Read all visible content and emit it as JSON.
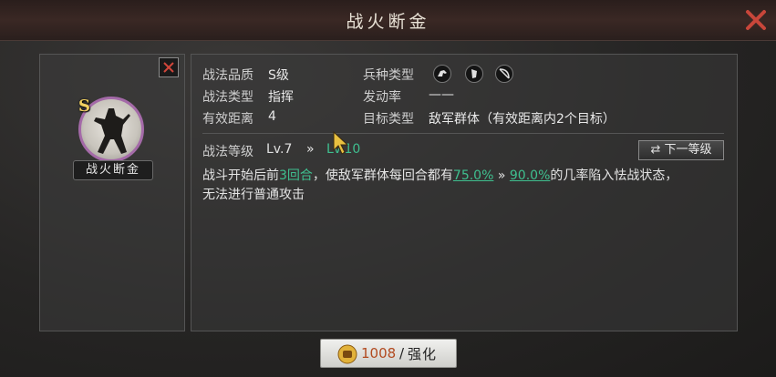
{
  "window": {
    "title": "战火断金"
  },
  "tactic": {
    "grade_badge": "S",
    "name": "战火断金"
  },
  "attributes": {
    "quality_label": "战法品质",
    "quality_value": "S级",
    "type_label": "战法类型",
    "type_value": "指挥",
    "range_label": "有效距离",
    "range_value": "4",
    "unit_label": "兵种类型",
    "unit_icons": [
      "cavalry-icon",
      "shield-icon",
      "bow-icon"
    ],
    "rate_label": "发动率",
    "rate_value": "——",
    "target_label": "目标类型",
    "target_value": "敌军群体（有效距离内2个目标）"
  },
  "level": {
    "label": "战法等级",
    "current": "Lv.7",
    "arrow": "»",
    "next": "Lv.10",
    "next_button_label": "下一等级"
  },
  "description": {
    "part1": "战斗开始后前",
    "rounds": "3回合",
    "part2": "，使敌军群体每回合都有",
    "rate_from": "75.0%",
    "arrow": "»",
    "rate_to": "90.0%",
    "part3": "的几率陷入怯战状态，",
    "line2": "无法进行普通攻击"
  },
  "upgrade": {
    "cost": "1008",
    "slash": "/",
    "label": "强化"
  },
  "colors": {
    "accent_green": "#3fbf8f",
    "grade_gold": "#f2d060",
    "close_red": "#c0392b",
    "portrait_ring": "#a46aa8"
  }
}
